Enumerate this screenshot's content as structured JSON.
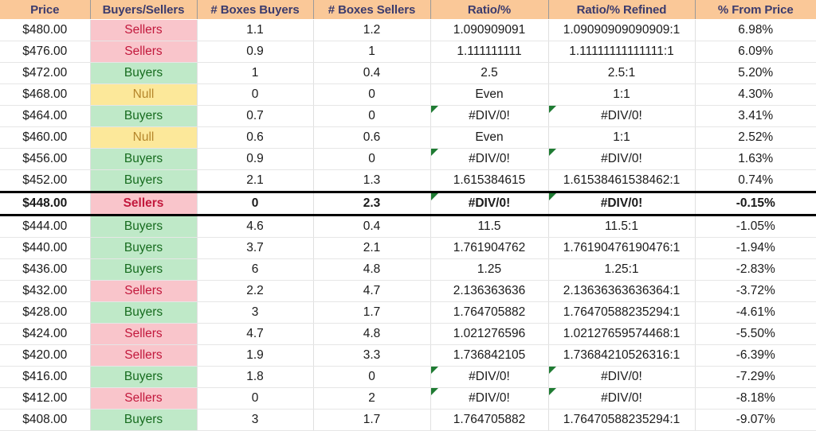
{
  "table": {
    "columns": [
      {
        "key": "price",
        "label": "Price"
      },
      {
        "key": "signal",
        "label": "Buyers/Sellers"
      },
      {
        "key": "boxes_buyers",
        "label": "# Boxes Buyers"
      },
      {
        "key": "boxes_sellers",
        "label": "# Boxes Sellers"
      },
      {
        "key": "ratio",
        "label": "Ratio/%"
      },
      {
        "key": "ratio_refined",
        "label": "Ratio/% Refined"
      },
      {
        "key": "pct_from_price",
        "label": "% From Price"
      }
    ],
    "colors": {
      "header_bg": "#fac898",
      "header_text": "#3b3b6d",
      "buyers_bg": "#bfe9c8",
      "buyers_text": "#166b1e",
      "sellers_bg": "#f9c5cb",
      "sellers_text": "#c2183c",
      "null_bg": "#fce89a",
      "null_text": "#b5862b",
      "error_flag": "#1e7b32",
      "focus_border": "#000000"
    },
    "rows": [
      {
        "price": "$480.00",
        "signal": "Sellers",
        "boxes_buyers": "1.1",
        "boxes_sellers": "1.2",
        "ratio": "1.090909091",
        "ratio_refined": "1.09090909090909:1",
        "pct_from_price": "6.98%",
        "error": false,
        "focus": false
      },
      {
        "price": "$476.00",
        "signal": "Sellers",
        "boxes_buyers": "0.9",
        "boxes_sellers": "1",
        "ratio": "1.111111111",
        "ratio_refined": "1.11111111111111:1",
        "pct_from_price": "6.09%",
        "error": false,
        "focus": false
      },
      {
        "price": "$472.00",
        "signal": "Buyers",
        "boxes_buyers": "1",
        "boxes_sellers": "0.4",
        "ratio": "2.5",
        "ratio_refined": "2.5:1",
        "pct_from_price": "5.20%",
        "error": false,
        "focus": false
      },
      {
        "price": "$468.00",
        "signal": "Null",
        "boxes_buyers": "0",
        "boxes_sellers": "0",
        "ratio": "Even",
        "ratio_refined": "1:1",
        "pct_from_price": "4.30%",
        "error": false,
        "focus": false
      },
      {
        "price": "$464.00",
        "signal": "Buyers",
        "boxes_buyers": "0.7",
        "boxes_sellers": "0",
        "ratio": "#DIV/0!",
        "ratio_refined": "#DIV/0!",
        "pct_from_price": "3.41%",
        "error": true,
        "focus": false
      },
      {
        "price": "$460.00",
        "signal": "Null",
        "boxes_buyers": "0.6",
        "boxes_sellers": "0.6",
        "ratio": "Even",
        "ratio_refined": "1:1",
        "pct_from_price": "2.52%",
        "error": false,
        "focus": false
      },
      {
        "price": "$456.00",
        "signal": "Buyers",
        "boxes_buyers": "0.9",
        "boxes_sellers": "0",
        "ratio": "#DIV/0!",
        "ratio_refined": "#DIV/0!",
        "pct_from_price": "1.63%",
        "error": true,
        "focus": false
      },
      {
        "price": "$452.00",
        "signal": "Buyers",
        "boxes_buyers": "2.1",
        "boxes_sellers": "1.3",
        "ratio": "1.615384615",
        "ratio_refined": "1.61538461538462:1",
        "pct_from_price": "0.74%",
        "error": false,
        "focus": false
      },
      {
        "price": "$448.00",
        "signal": "Sellers",
        "boxes_buyers": "0",
        "boxes_sellers": "2.3",
        "ratio": "#DIV/0!",
        "ratio_refined": "#DIV/0!",
        "pct_from_price": "-0.15%",
        "error": true,
        "focus": true
      },
      {
        "price": "$444.00",
        "signal": "Buyers",
        "boxes_buyers": "4.6",
        "boxes_sellers": "0.4",
        "ratio": "11.5",
        "ratio_refined": "11.5:1",
        "pct_from_price": "-1.05%",
        "error": false,
        "focus": false
      },
      {
        "price": "$440.00",
        "signal": "Buyers",
        "boxes_buyers": "3.7",
        "boxes_sellers": "2.1",
        "ratio": "1.761904762",
        "ratio_refined": "1.76190476190476:1",
        "pct_from_price": "-1.94%",
        "error": false,
        "focus": false
      },
      {
        "price": "$436.00",
        "signal": "Buyers",
        "boxes_buyers": "6",
        "boxes_sellers": "4.8",
        "ratio": "1.25",
        "ratio_refined": "1.25:1",
        "pct_from_price": "-2.83%",
        "error": false,
        "focus": false
      },
      {
        "price": "$432.00",
        "signal": "Sellers",
        "boxes_buyers": "2.2",
        "boxes_sellers": "4.7",
        "ratio": "2.136363636",
        "ratio_refined": "2.13636363636364:1",
        "pct_from_price": "-3.72%",
        "error": false,
        "focus": false
      },
      {
        "price": "$428.00",
        "signal": "Buyers",
        "boxes_buyers": "3",
        "boxes_sellers": "1.7",
        "ratio": "1.764705882",
        "ratio_refined": "1.76470588235294:1",
        "pct_from_price": "-4.61%",
        "error": false,
        "focus": false
      },
      {
        "price": "$424.00",
        "signal": "Sellers",
        "boxes_buyers": "4.7",
        "boxes_sellers": "4.8",
        "ratio": "1.021276596",
        "ratio_refined": "1.02127659574468:1",
        "pct_from_price": "-5.50%",
        "error": false,
        "focus": false
      },
      {
        "price": "$420.00",
        "signal": "Sellers",
        "boxes_buyers": "1.9",
        "boxes_sellers": "3.3",
        "ratio": "1.736842105",
        "ratio_refined": "1.73684210526316:1",
        "pct_from_price": "-6.39%",
        "error": false,
        "focus": false
      },
      {
        "price": "$416.00",
        "signal": "Buyers",
        "boxes_buyers": "1.8",
        "boxes_sellers": "0",
        "ratio": "#DIV/0!",
        "ratio_refined": "#DIV/0!",
        "pct_from_price": "-7.29%",
        "error": true,
        "focus": false
      },
      {
        "price": "$412.00",
        "signal": "Sellers",
        "boxes_buyers": "0",
        "boxes_sellers": "2",
        "ratio": "#DIV/0!",
        "ratio_refined": "#DIV/0!",
        "pct_from_price": "-8.18%",
        "error": true,
        "focus": false
      },
      {
        "price": "$408.00",
        "signal": "Buyers",
        "boxes_buyers": "3",
        "boxes_sellers": "1.7",
        "ratio": "1.764705882",
        "ratio_refined": "1.76470588235294:1",
        "pct_from_price": "-9.07%",
        "error": false,
        "focus": false
      }
    ]
  }
}
